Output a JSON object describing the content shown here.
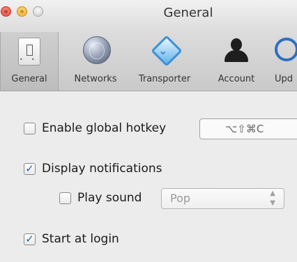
{
  "window": {
    "title": "General"
  },
  "toolbar": {
    "items": [
      {
        "label": "General",
        "selected": true,
        "icon": "switch-icon"
      },
      {
        "label": "Networks",
        "icon": "globe-icon"
      },
      {
        "label": "Transporter",
        "icon": "transporter-icon"
      },
      {
        "label": "Account",
        "icon": "account-icon"
      },
      {
        "label": "Upd",
        "icon": "updates-icon"
      }
    ]
  },
  "settings": {
    "global_hotkey": {
      "label": "Enable global hotkey",
      "checked": false,
      "value": "⌥⇧⌘C"
    },
    "display_notifications": {
      "label": "Display notifications",
      "checked": true
    },
    "play_sound": {
      "label": "Play sound",
      "checked": false,
      "selected_sound": "Pop"
    },
    "start_at_login": {
      "label": "Start at login",
      "checked": true
    }
  },
  "colors": {
    "accent": "#1f5fb5",
    "window_bg": "#ececec"
  }
}
